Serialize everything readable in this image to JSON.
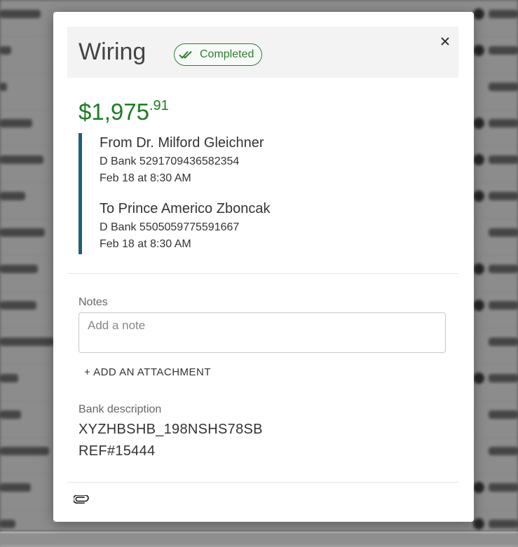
{
  "modal": {
    "title": "Wiring",
    "status": "Completed",
    "amount": {
      "dollars": "$1,975",
      "cents": ".91"
    },
    "from": {
      "name": "From Dr. Milford Gleichner",
      "account": "D Bank 5291709436582354",
      "date": "Feb 18 at 8:30 AM"
    },
    "to": {
      "name": "To Prince Americo Zboncak",
      "account": "D Bank 5505059775591667",
      "date": "Feb 18 at 8:30 AM"
    },
    "notes": {
      "label": "Notes",
      "placeholder": "Add a note"
    },
    "attachment_button": "+ ADD AN ATTACHMENT",
    "bank_description": {
      "label": "Bank description",
      "lines": [
        "XYZHBSHB_198NSHS78SB",
        "REF#15444"
      ]
    }
  },
  "colors": {
    "status_green": "#2e7d32",
    "amount_green": "#1b7d23",
    "accent_bar": "#1f5f78"
  },
  "icons": [
    "double-check-icon",
    "close-icon",
    "paperclip-icon"
  ]
}
